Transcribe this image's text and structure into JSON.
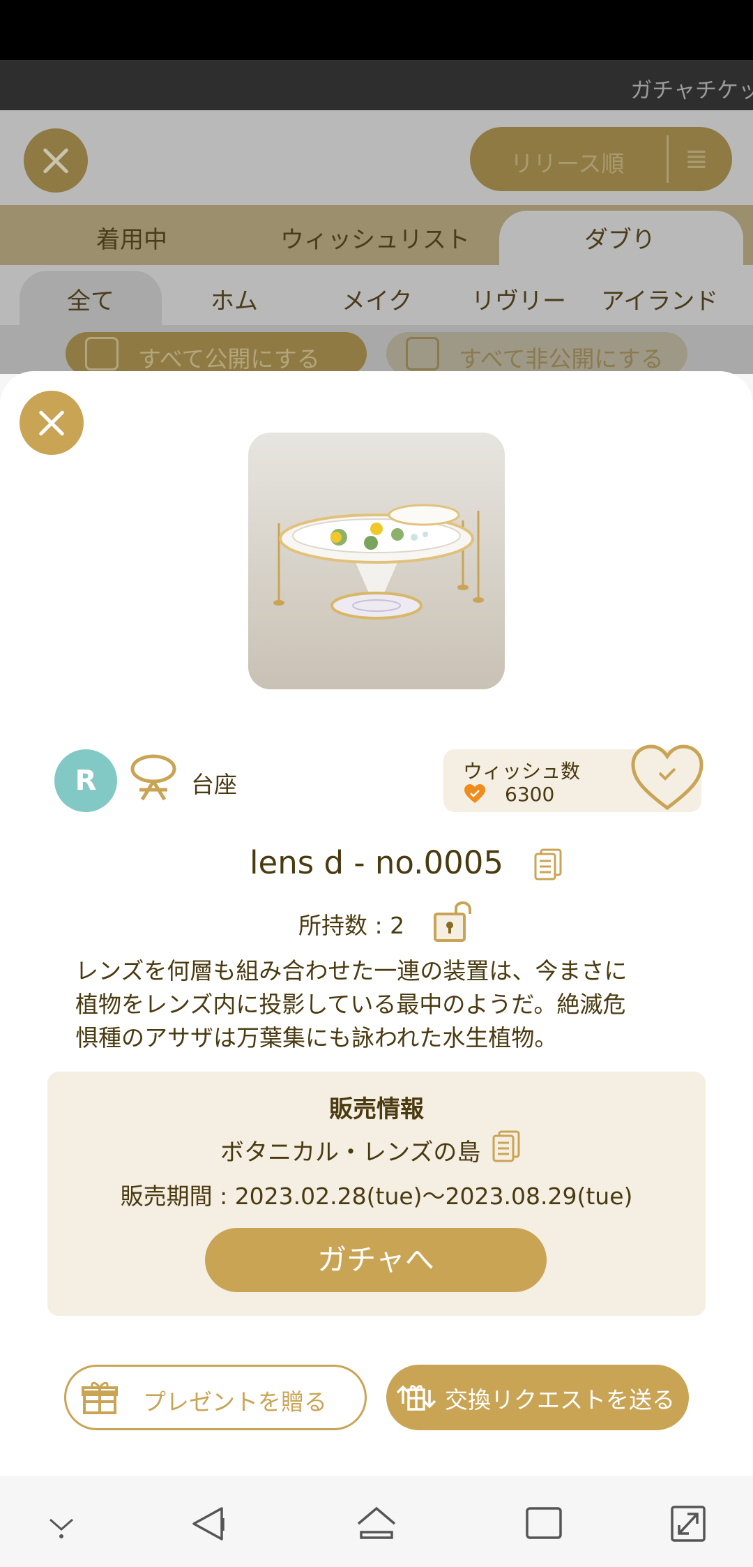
{
  "background": {
    "ticket_text": "ガチャチケッ",
    "sort_label": "リリース順",
    "tabs": [
      "着用中",
      "ウィッシュリスト",
      "ダブり"
    ],
    "subtabs": [
      "全て",
      "ホム",
      "メイク",
      "リヴリー",
      "アイランド"
    ],
    "publish_all": "すべて公開にする",
    "private_all": "すべて非公開にする"
  },
  "item": {
    "rarity": "R",
    "category": "台座",
    "wish_label": "ウィッシュ数",
    "wish_count": "6300",
    "title": "lens d - no.0005",
    "owned": "所持数 : 2",
    "description": "レンズを何層も組み合わせた一連の装置は、今まさに植物をレンズ内に投影している最中のようだ。絶滅危惧種のアサザは万葉集にも詠われた水生植物。"
  },
  "sales": {
    "title": "販売情報",
    "series": "ボタニカル・レンズの島",
    "period": "販売期間 : 2023.02.28(tue)〜2023.08.29(tue)",
    "gacha_button": "ガチャへ"
  },
  "actions": {
    "present": "プレゼントを贈る",
    "trade": "交換リクエストを送る"
  },
  "colors": {
    "accent": "#c9a454",
    "panel": "#f5efe3",
    "text": "#4a3a10",
    "rarity": "#82c8c5"
  }
}
